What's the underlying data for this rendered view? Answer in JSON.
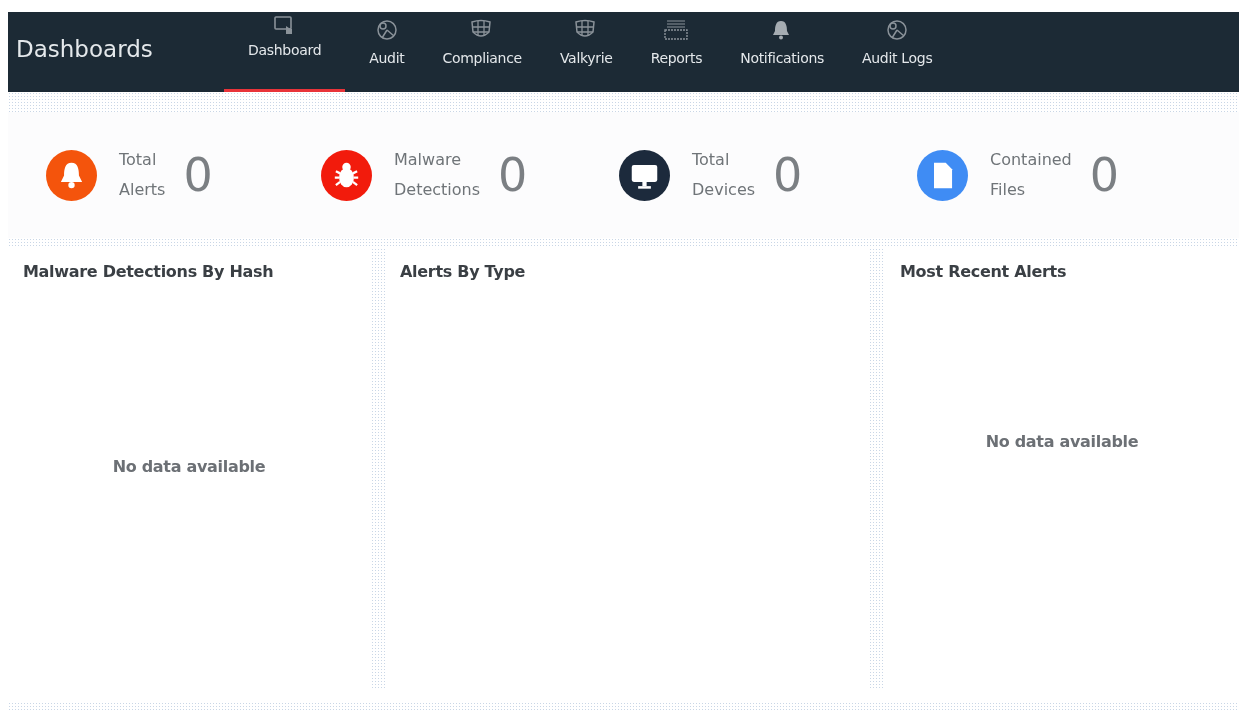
{
  "header": {
    "title": "Dashboards"
  },
  "tabs": [
    {
      "label": "Dashboard",
      "kind": "screen",
      "selected": true
    },
    {
      "label": "Audit",
      "kind": "pie",
      "selected": false
    },
    {
      "label": "Compliance",
      "kind": "shield",
      "selected": false
    },
    {
      "label": "Valkyrie",
      "kind": "shield",
      "selected": false
    },
    {
      "label": "Reports",
      "kind": "tray",
      "selected": false
    },
    {
      "label": "Notifications",
      "kind": "bell",
      "selected": false
    },
    {
      "label": "Audit Logs",
      "kind": "pie",
      "selected": false
    }
  ],
  "stats": [
    {
      "label_line1": "Total",
      "label_line2": "Alerts",
      "value": "0",
      "kind": "bell",
      "color": "#f4540c"
    },
    {
      "label_line1": "Malware",
      "label_line2": "Detections",
      "value": "0",
      "kind": "bug",
      "color": "#f21b0c"
    },
    {
      "label_line1": "Total",
      "label_line2": "Devices",
      "value": "0",
      "kind": "monitor",
      "color": "#1c2a3c"
    },
    {
      "label_line1": "Contained",
      "label_line2": "Files",
      "value": "0",
      "kind": "file",
      "color": "#3f8cf4"
    }
  ],
  "panels": [
    {
      "title": "Malware Detections By Hash",
      "message": "No data available"
    },
    {
      "title": "Alerts By Type"
    },
    {
      "title": "Most Recent Alerts",
      "message": "No data available"
    }
  ]
}
